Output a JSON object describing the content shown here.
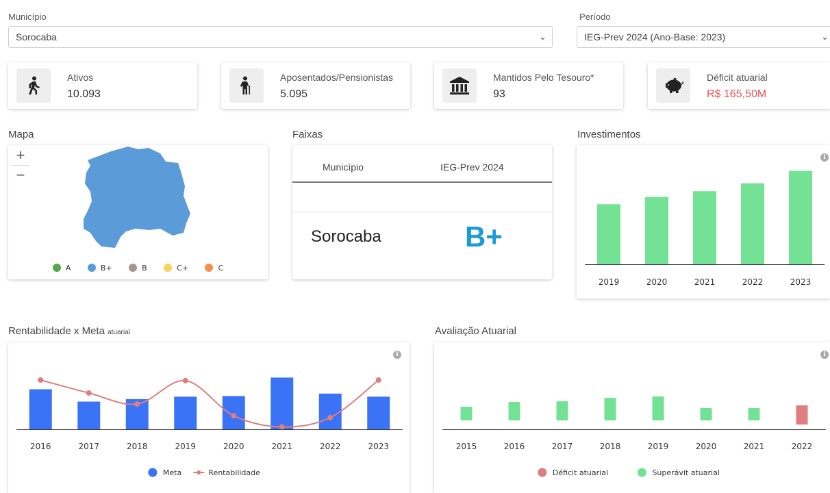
{
  "filters": {
    "municipio": {
      "label": "Município",
      "value": "Sorocaba"
    },
    "periodo": {
      "label": "Período",
      "value": "IEG-Prev 2024 (Ano-Base: 2023)"
    }
  },
  "stats": [
    {
      "label": "Ativos",
      "value": "10.093",
      "icon": "walking-person-icon"
    },
    {
      "label": "Aposentados/Pensionistas",
      "value": "5.095",
      "icon": "elderly-person-icon"
    },
    {
      "label": "Mantidos Pelo Tesouro*",
      "value": "93",
      "icon": "bank-icon"
    },
    {
      "label": "Déficit atuarial",
      "value": "R$ 165,50M",
      "icon": "piggy-bank-icon",
      "value_color": "#e8534f"
    }
  ],
  "mapa": {
    "title": "Mapa",
    "zoom_in": "+",
    "zoom_out": "−",
    "legend": [
      {
        "label": "A",
        "color": "#52a84a"
      },
      {
        "label": "B+",
        "color": "#5a9bd8"
      },
      {
        "label": "B",
        "color": "#a6958f"
      },
      {
        "label": "C+",
        "color": "#f5d55b"
      },
      {
        "label": "C",
        "color": "#f0924e"
      }
    ]
  },
  "faixas": {
    "title": "Faixas",
    "col1": "Município",
    "col2": "IEG-Prev 2024",
    "row_municipio": "Sorocaba",
    "row_grade": "B+",
    "grade_color": "#1a9ad6"
  },
  "sections": {
    "investimentos": "Investimentos",
    "rentabilidade": "Rentabilidade x Meta",
    "rentabilidade_small": "atuarial",
    "avaliacao": "Avaliação Atuarial"
  },
  "chart_data": [
    {
      "type": "bar",
      "categories": [
        "2019",
        "2020",
        "2021",
        "2022",
        "2023"
      ],
      "values": [
        83,
        93,
        101,
        112,
        129
      ],
      "ylim": [
        0,
        140
      ],
      "color": "#74e295",
      "grid": false
    },
    {
      "type": "bar",
      "categories": [
        "2016",
        "2017",
        "2018",
        "2019",
        "2020",
        "2021",
        "2022",
        "2023"
      ],
      "series": [
        {
          "name": "Meta",
          "type": "bar",
          "color": "#3a73f5",
          "values": [
            65,
            45,
            49,
            53,
            54,
            84,
            58,
            53
          ]
        },
        {
          "name": "Rentabilidade",
          "type": "line",
          "color": "#e07e7e",
          "values": [
            80,
            59,
            41,
            79,
            22,
            4,
            19,
            80
          ]
        }
      ],
      "ylim": [
        0,
        100
      ],
      "legend": "bottom"
    },
    {
      "type": "bar",
      "categories": [
        "2015",
        "2016",
        "2017",
        "2018",
        "2019",
        "2020",
        "2021",
        "2022"
      ],
      "series": [
        {
          "name": "Déficit atuarial",
          "color": "#e07e7e",
          "values": [
            0,
            0,
            0,
            0,
            0,
            0,
            0,
            -28
          ]
        },
        {
          "name": "Superávit atuarial",
          "color": "#74e295",
          "values": [
            20,
            27,
            28,
            33,
            35,
            18,
            18,
            0
          ]
        }
      ],
      "ylim": [
        -40,
        40
      ],
      "legend": "bottom"
    }
  ]
}
